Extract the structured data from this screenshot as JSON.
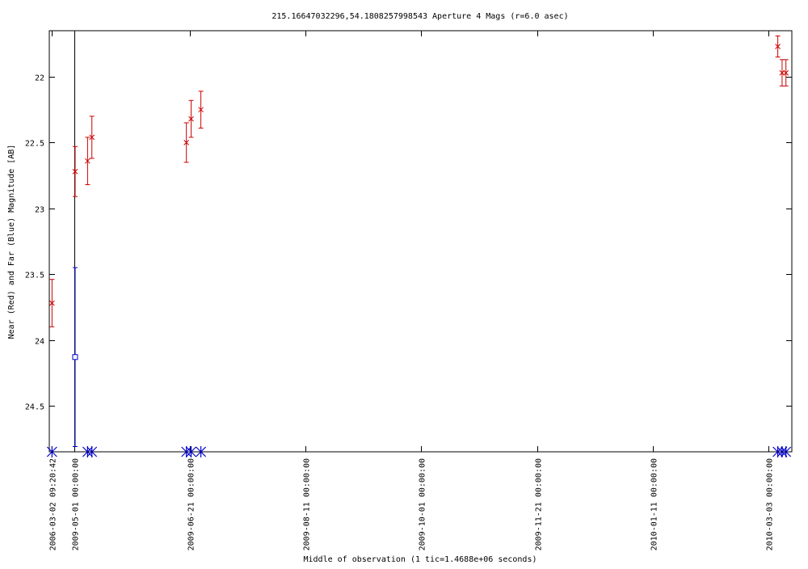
{
  "chart_data": {
    "type": "scatter",
    "title": "215.16647032296,54.1808257998543   Aperture 4 Mags (r=6.0 asec)",
    "xlabel": "Middle of observation (1 tic=1.4688e+06 seconds)",
    "ylabel": "Near (Red) and Far (Blue) Magnitude [AB]",
    "y_inverted": true,
    "ylim": [
      21.65,
      24.85
    ],
    "yticks": [
      22,
      22.5,
      23,
      23.5,
      24,
      24.5
    ],
    "ytick_labels": [
      "22",
      "22.5",
      "23",
      "23.5",
      "24",
      "24.5"
    ],
    "x_unit": "days since 2009-05-01 00:00:00",
    "xlim": [
      -11.2,
      316.5
    ],
    "xticks": [
      {
        "label": "2006-03-02 09:20:42",
        "x": -10.0
      },
      {
        "label": "2009-05-01 00:00:00",
        "x": 0
      },
      {
        "label": "2009-06-21 00:00:00",
        "x": 51
      },
      {
        "label": "2009-08-11 00:00:00",
        "x": 102
      },
      {
        "label": "2009-10-01 00:00:00",
        "x": 153
      },
      {
        "label": "2009-11-21 00:00:00",
        "x": 204
      },
      {
        "label": "2010-01-11 00:00:00",
        "x": 255
      },
      {
        "label": "2010-03-03 00:00:00",
        "x": 306
      }
    ],
    "break_line_x": -0.1,
    "grid": false,
    "series": [
      {
        "name": "Near",
        "color": "#cc0000",
        "marker": "x",
        "points": [
          {
            "x": -10.0,
            "y": 23.72,
            "err": 0.18
          },
          {
            "x": 0.2,
            "y": 22.72,
            "err": 0.19
          },
          {
            "x": 5.7,
            "y": 22.64,
            "err": 0.18
          },
          {
            "x": 7.6,
            "y": 22.46,
            "err": 0.16
          },
          {
            "x": 49.3,
            "y": 22.5,
            "err": 0.15
          },
          {
            "x": 51.4,
            "y": 22.32,
            "err": 0.14
          },
          {
            "x": 55.7,
            "y": 22.25,
            "err": 0.14
          },
          {
            "x": 310.3,
            "y": 21.77,
            "err": 0.08
          },
          {
            "x": 312.2,
            "y": 21.97,
            "err": 0.1
          },
          {
            "x": 313.9,
            "y": 21.97,
            "err": 0.1
          }
        ]
      },
      {
        "name": "Far",
        "color": "#0000cc",
        "marker": "square",
        "points": [
          {
            "x": 0.2,
            "y": 24.13,
            "err": 0.68
          }
        ]
      },
      {
        "name": "Far non-detections",
        "color": "#0000cc",
        "marker": "star",
        "at_axis_bottom": true,
        "x": [
          -10.0,
          5.7,
          7.6,
          49.3,
          51.4,
          55.7,
          310.3,
          312.2,
          313.9
        ]
      }
    ]
  }
}
